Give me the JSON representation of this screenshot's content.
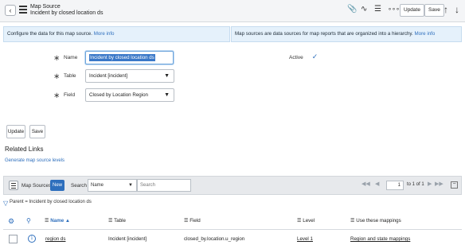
{
  "header": {
    "title": "Map Source",
    "subtitle": "Incident by closed location ds",
    "update_label": "Update",
    "save_label": "Save"
  },
  "info_bars": {
    "left_text": "Configure the data for this map source.",
    "left_link": "More info",
    "right_text": "Map sources are data sources for map reports that are organized into a hierarchy.",
    "right_link": "More info"
  },
  "form": {
    "name_label": "Name",
    "name_value": "Incident by closed location ds",
    "table_label": "Table",
    "table_value": "Incident [incident]",
    "field_label": "Field",
    "field_value": "Closed by Location Region",
    "active_label": "Active",
    "active_checked": true
  },
  "actions": {
    "update_label": "Update",
    "save_label": "Save"
  },
  "related_links": {
    "title": "Related Links",
    "link": "Generate map source levels"
  },
  "list": {
    "title": "Map Sources",
    "new_label": "New",
    "search_label": "Search",
    "search_field": "Name",
    "search_placeholder": "Search",
    "page_value": "1",
    "page_total": "to 1 of 1",
    "breadcrumb": "Parent = Incident by closed location ds",
    "columns": {
      "name": "Name",
      "table": "Table",
      "field": "Field",
      "level": "Level",
      "mappings": "Use these mappings"
    },
    "rows": [
      {
        "name": "region ds",
        "table": "Incident [incident]",
        "field": "closed_by.location.u_region",
        "level": "Level 1",
        "mappings": "Region and state mappings"
      }
    ]
  }
}
